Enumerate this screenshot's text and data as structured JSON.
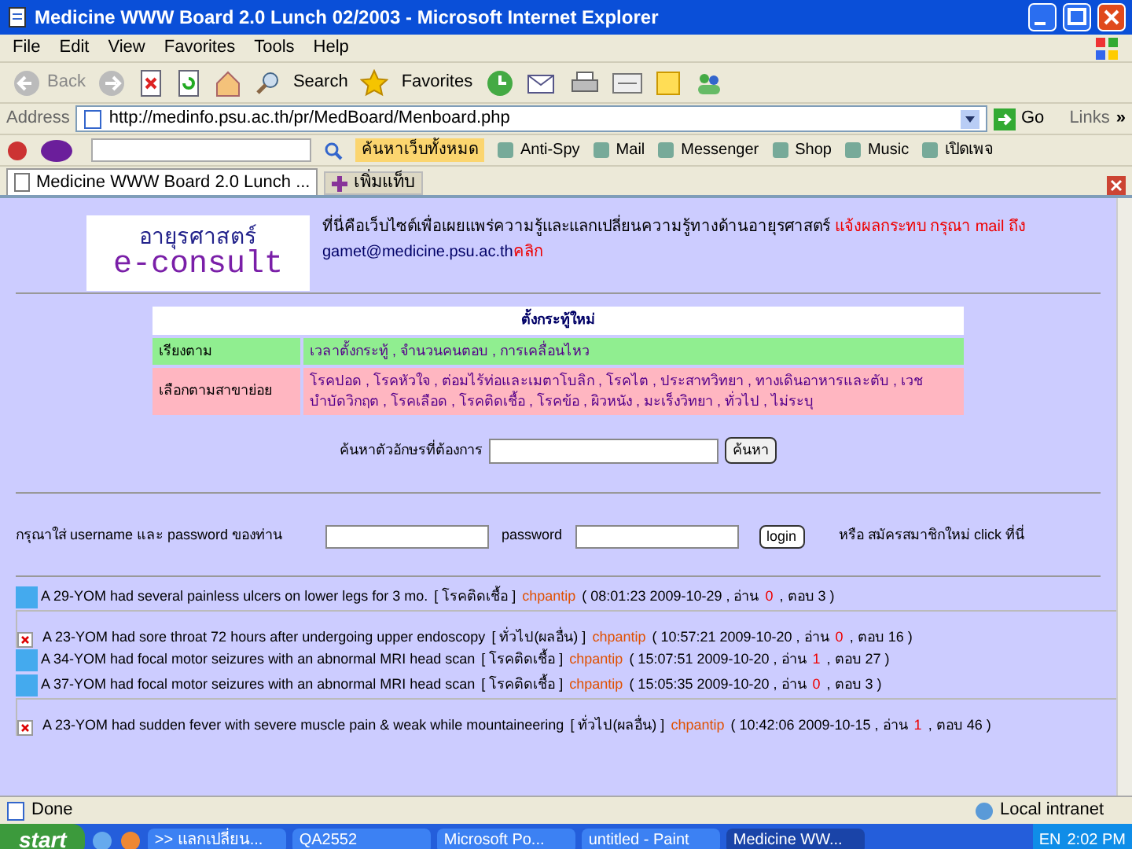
{
  "window": {
    "title": "Medicine WWW Board 2.0 Lunch 02/2003 - Microsoft Internet Explorer"
  },
  "menu": [
    "File",
    "Edit",
    "View",
    "Favorites",
    "Tools",
    "Help"
  ],
  "toolbar": {
    "back": "Back",
    "search": "Search",
    "favorites": "Favorites"
  },
  "address": {
    "label": "Address",
    "url": "http://medinfo.psu.ac.th/pr/MedBoard/Menboard.php",
    "go": "Go",
    "links": "Links",
    "more": "»"
  },
  "yahoo_bar": {
    "search_button": "ค้นหาเว็บทั้งหมด",
    "items": [
      "Anti-Spy",
      "Mail",
      "Messenger",
      "Shop",
      "Music",
      "เปิดเพจ"
    ]
  },
  "tabs": [
    {
      "label": "Medicine WWW Board 2.0 Lunch ...",
      "selected": true,
      "kind": "page"
    },
    {
      "label": "เพิ่มแท็บ",
      "selected": false,
      "kind": "new"
    }
  ],
  "page": {
    "intro": "ที่นี่คือเว็บไซต์เพื่อเผยแพร่ความรู้และแลกเปลี่ยนความรู้ทางด้านอายุรศาสตร์",
    "report": "แจ้งผลกระทบ กรุณา mail ถึง",
    "email": "gamet@medicine.psu.ac.th",
    "click": "คลิก",
    "logo": {
      "thai": "อายุรศาสตร์",
      "latin": "e-consult"
    },
    "table": {
      "header": "ตั้งกระทู้ใหม่",
      "rows": [
        {
          "label": "เรียงตาม",
          "value": "เวลาตั้งกระทู้ , จำนวนคนตอบ , การเคลื่อนไหว",
          "color": "#90ee90"
        },
        {
          "label": "เลือกตามสาขาย่อย",
          "value": "โรคปอด , โรคหัวใจ , ต่อมไร้ท่อและเมตาโบลิก , โรคไต , ประสาทวิทยา , ทางเดินอาหารและตับ , เวชบำบัดวิกฤต , โรคเลือด , โรคติดเชื้อ , โรคข้อ , ผิวหนัง , มะเร็งวิทยา , ทั่วไป , ไม่ระบุ",
          "color": "#ffb6c1"
        }
      ]
    },
    "search": {
      "label": "ค้นหาตัวอักษรที่ต้องการ",
      "button": "ค้นหา"
    },
    "login": {
      "prompt": "กรุณาใส่ username และ password ของท่าน",
      "password_label": "password",
      "button": "login",
      "register": "หรือ สมัครสมาชิกใหม่ click ที่นี่"
    },
    "posts": [
      {
        "kind": "square",
        "title": "A 29-YOM had several painless ulcers on lower legs for 3 mo.",
        "category": "[ โรคติดเชื้อ ]",
        "author": "chpantip",
        "stamp": "( 08:01:23 2009-10-29 , อ่าน",
        "reads": "0",
        "replies": ", ตอบ 3 )"
      },
      {
        "kind": "broken",
        "title": "A 23-YOM had sore throat 72 hours after undergoing upper endoscopy",
        "category": "[ ทั่วไป(ผลอื่น) ]",
        "author": "chpantip",
        "stamp": "( 10:57:21 2009-10-20 , อ่าน",
        "reads": "0",
        "replies": ", ตอบ 16 )"
      },
      {
        "kind": "square",
        "title": "A 34-YOM had focal motor seizures with an abnormal MRI head scan",
        "category": "[ โรคติดเชื้อ ]",
        "author": "chpantip",
        "stamp": "( 15:07:51 2009-10-20 , อ่าน",
        "reads": "1",
        "replies": ", ตอบ 27 )"
      },
      {
        "kind": "square",
        "title": "A 37-YOM had focal motor seizures with an abnormal MRI head scan",
        "category": "[ โรคติดเชื้อ ]",
        "author": "chpantip",
        "stamp": "( 15:05:35 2009-10-20 , อ่าน",
        "reads": "0",
        "replies": ", ตอบ 3 )"
      },
      {
        "kind": "broken",
        "title": "A 23-YOM had sudden fever with severe muscle pain & weak while mountaineering",
        "category": "[ ทั่วไป(ผลอื่น) ]",
        "author": "chpantip",
        "stamp": "( 10:42:06 2009-10-15 , อ่าน",
        "reads": "1",
        "replies": ", ตอบ 46 )"
      }
    ]
  },
  "status_bar": {
    "text": "Done",
    "zone": "Local intranet"
  },
  "taskbar": {
    "start": "start",
    "tasks": [
      {
        "label": ">> แลกเปลี่ยน...",
        "selected": false
      },
      {
        "label": "QA2552",
        "selected": false
      },
      {
        "label": "Microsoft Po...",
        "selected": false
      },
      {
        "label": "untitled - Paint",
        "selected": false
      },
      {
        "label": "Medicine WW...",
        "selected": true
      }
    ],
    "lang": "EN",
    "clock": "2:02 PM"
  }
}
